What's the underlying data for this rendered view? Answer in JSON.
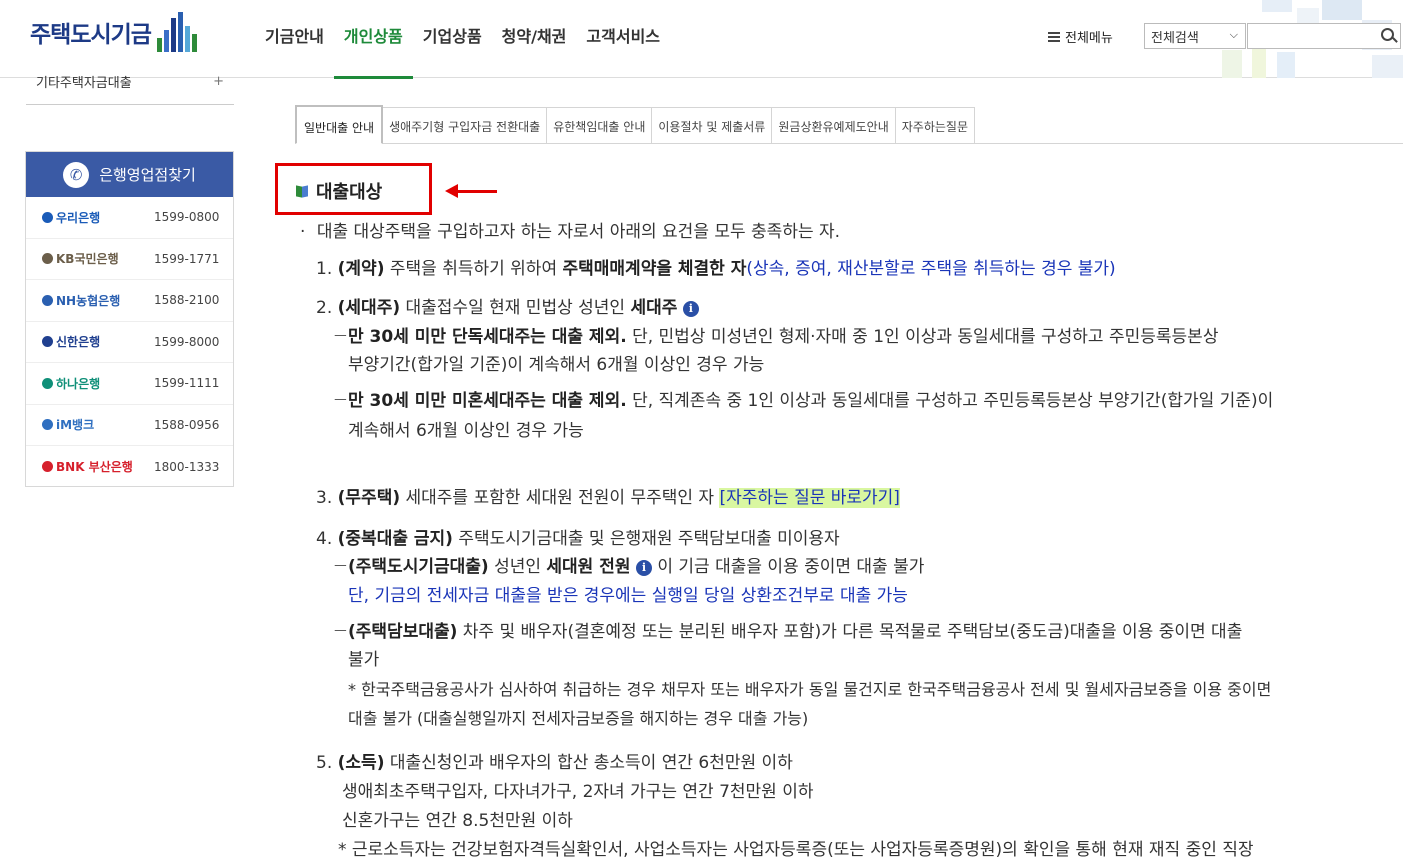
{
  "header": {
    "logo_text": "주택도시기금",
    "gnb": [
      "기금안내",
      "개인상품",
      "기업상품",
      "청약/채권",
      "고객서비스"
    ],
    "active_gnb_index": 1,
    "all_menu": "전체메뉴",
    "search_select": "전체검색",
    "search_placeholder": ""
  },
  "sidebar": {
    "top_item": "기타주택자금대출",
    "top_item_icon": "+",
    "bank_finder_title": "은행영업점찾기",
    "banks": [
      {
        "name": "우리은행",
        "phone": "1599-0800",
        "color": "#1a5bb8"
      },
      {
        "name": "KB국민은행",
        "phone": "1599-1771",
        "color": "#6b5e4a"
      },
      {
        "name": "NH농협은행",
        "phone": "1588-2100",
        "color": "#2a5fb0"
      },
      {
        "name": "신한은행",
        "phone": "1599-8000",
        "color": "#1f3f8f"
      },
      {
        "name": "하나은행",
        "phone": "1599-1111",
        "color": "#0f8f78"
      },
      {
        "name": "iM뱅크",
        "phone": "1588-0956",
        "color": "#2f6fc0"
      },
      {
        "name": "BNK 부산은행",
        "phone": "1800-1333",
        "color": "#d6202c"
      }
    ]
  },
  "tabs": [
    "일반대출 안내",
    "생애주기형 구입자금 전환대출",
    "유한책임대출 안내",
    "이용절차 및 제출서류",
    "원금상환유예제도안내",
    "자주하는질문"
  ],
  "active_tab_index": 0,
  "content": {
    "section_title": "대출대상",
    "intro": "대출 대상주택을 구입하고자 하는 자로서 아래의 요건을 모두 충족하는 자.",
    "i1": {
      "num": "1.",
      "head": "(계약)",
      "t1": "주택을 취득하기 위하여",
      "bold": "주택매매계약을 체결한 자",
      "blue": "(상속, 증여, 재산분할로 주택을 취득하는 경우 불가)"
    },
    "i2": {
      "num": "2.",
      "head": "(세대주)",
      "t1": "대출접수일 현재 민법상 성년인",
      "bold": "세대주",
      "s1_bold": "만 30세 미만 단독세대주는 대출 제외.",
      "s1_t": "단, 민법상 미성년인 형제·자매 중 1인 이상과 동일세대를 구성하고 주민등록등본상",
      "s1_t2": "부양기간(합가일 기준)이 계속해서 6개월 이상인 경우 가능",
      "s2_bold": "만 30세 미만 미혼세대주는 대출 제외.",
      "s2_t": "단, 직계존속 중 1인 이상과 동일세대를 구성하고 주민등록등본상 부양기간(합가일 기준)이",
      "s2_t2": "계속해서 6개월 이상인 경우 가능"
    },
    "i3": {
      "num": "3.",
      "head": "(무주택)",
      "t1": "세대주를 포함한 세대원 전원이 무주택인 자",
      "link": "[자주하는 질문 바로가기]"
    },
    "i4": {
      "num": "4.",
      "head": "(중복대출 금지)",
      "t1": "주택도시기금대출 및 은행재원 주택담보대출 미이용자",
      "s1_head": "(주택도시기금대출)",
      "s1_t": "성년인",
      "s1_bold": "세대원 전원",
      "s1_t2": "이 기금 대출을 이용 중이면 대출 불가",
      "s1_blue": "단, 기금의 전세자금 대출을 받은 경우에는 실행일 당일 상환조건부로 대출 가능",
      "s2_head": "(주택담보대출)",
      "s2_t": "차주 및 배우자(결혼예정 또는 분리된 배우자 포함)가 다른 목적물로 주택담보(중도금)대출을 이용 중이면 대출",
      "s2_t2": "불가",
      "note1": "* 한국주택금융공사가 심사하여 취급하는 경우 채무자 또는 배우자가 동일 물건지로 한국주택금융공사 전세 및 월세자금보증을 이용 중이면",
      "note2": "대출 불가 (대출실행일까지 전세자금보증을 해지하는 경우 대출 가능)"
    },
    "i5": {
      "num": "5.",
      "head": "(소득)",
      "t1": "대출신청인과 배우자의 합산 총소득이 연간 6천만원 이하",
      "l2": "생애최초주택구입자, 다자녀가구, 2자녀 가구는 연간 7천만원 이하",
      "l3": "신혼가구는 연간 8.5천만원 이하",
      "l4": "* 근로소득자는 건강보험자격득실확인서, 사업소득자는 사업자등록증(또는 사업자등록증명원)의 확인을 통해 현재 재직 중인 직장"
    }
  },
  "icons": {
    "dash": "ㅡ",
    "info": "i",
    "bullet": "·"
  }
}
